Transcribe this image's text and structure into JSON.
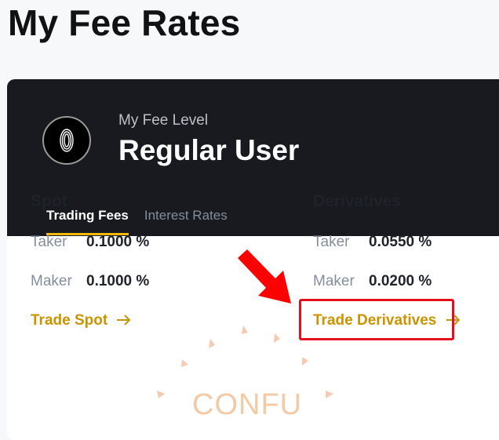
{
  "page": {
    "title": "My Fee Rates"
  },
  "fee_level": {
    "label": "My Fee Level",
    "name": "Regular User",
    "avatar_icon": "level-badge-icon"
  },
  "tabs": [
    {
      "label": "Trading Fees",
      "active": true
    },
    {
      "label": "Interest Rates",
      "active": false
    }
  ],
  "spot": {
    "title": "Spot",
    "taker_label": "Taker",
    "taker_value": "0.1000 %",
    "maker_label": "Maker",
    "maker_value": "0.1000 %",
    "link": "Trade Spot"
  },
  "derivatives": {
    "title": "Derivatives",
    "taker_label": "Taker",
    "taker_value": "0.0550 %",
    "maker_label": "Maker",
    "maker_value": "0.0200 %",
    "link": "Trade Derivatives"
  },
  "annotation": {
    "arrow_color": "#ff0000",
    "box_color": "#e4101b"
  },
  "watermark": {
    "text": "CONFU"
  },
  "colors": {
    "accent": "#f0b90b",
    "link": "#c99400",
    "header_bg": "#181a1f"
  }
}
